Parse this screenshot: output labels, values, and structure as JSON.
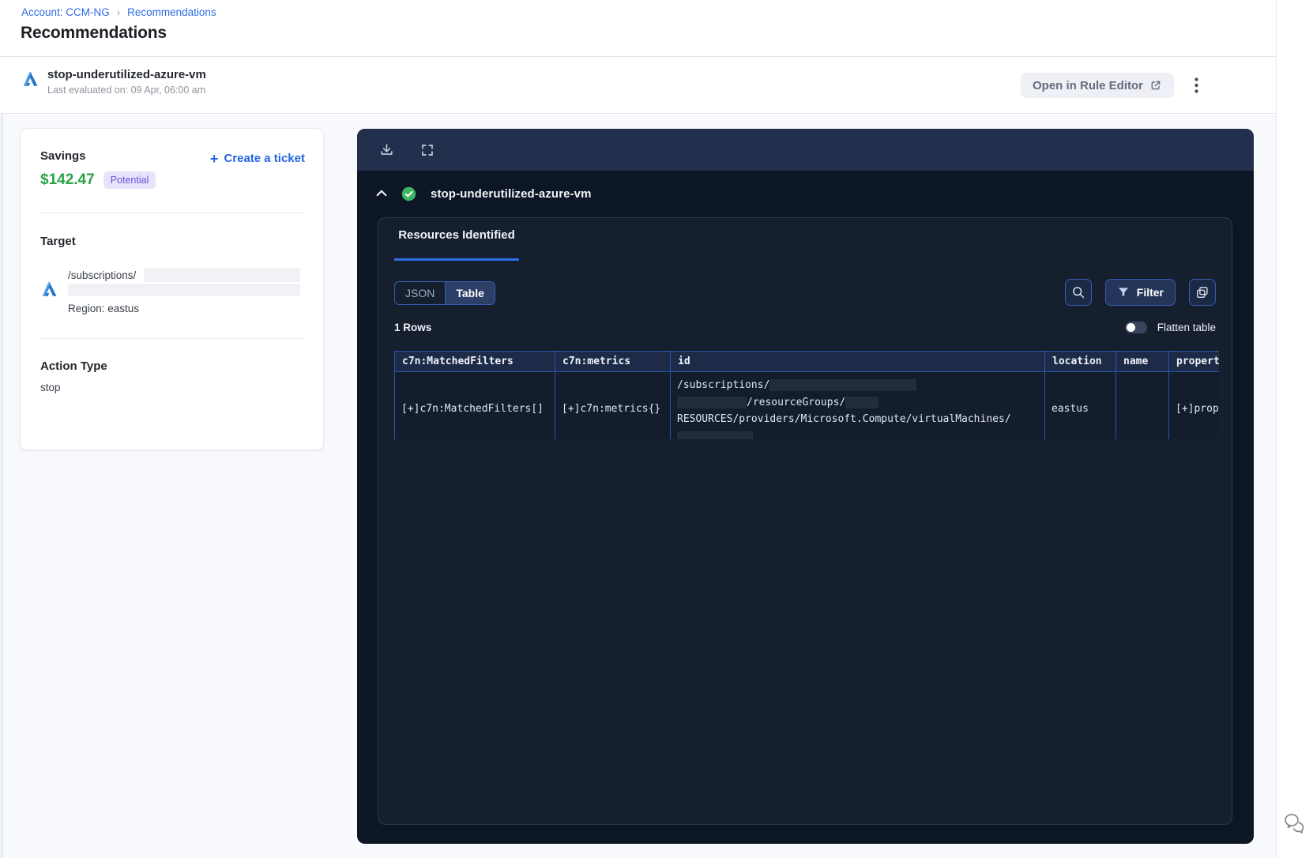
{
  "breadcrumb": {
    "account": "Account: CCM-NG",
    "separator": "›",
    "current": "Recommendations"
  },
  "page": {
    "title": "Recommendations"
  },
  "header": {
    "rule_name": "stop-underutilized-azure-vm",
    "last_evaluated": "Last evaluated on: 09 Apr, 06:00 am",
    "open_rule_editor_label": "Open in Rule Editor"
  },
  "card": {
    "savings_label": "Savings",
    "create_ticket_plus": "+",
    "create_ticket_label": "Create a ticket",
    "amount": "$142.47",
    "badge": "Potential",
    "target_label": "Target",
    "target_path": "/subscriptions/",
    "region": "Region: eastus",
    "action_type_label": "Action Type",
    "action_type_value": "stop"
  },
  "panel": {
    "rule_name": "stop-underutilized-azure-vm",
    "tab_label": "Resources Identified",
    "toggle": {
      "json_label": "JSON",
      "table_label": "Table"
    },
    "filter_label": "Filter",
    "rows_label": "1 Rows",
    "flatten_label": "Flatten table",
    "table": {
      "headers": [
        "c7n:MatchedFilters",
        "c7n:metrics",
        "id",
        "location",
        "name",
        "propert"
      ],
      "row": {
        "matched_filters": "[+]c7n:MatchedFilters[]",
        "metrics": "[+]c7n:metrics{}",
        "id_line1": "/subscriptions/",
        "id_line2": "/resourceGroups/",
        "id_line3": "RESOURCES/providers/Microsoft.Compute/virtualMachines/",
        "location": "eastus",
        "name": "",
        "properties": "[+]prop"
      }
    }
  },
  "colors": {
    "link_blue": "#2f6be4",
    "savings_green": "#27a346",
    "badge_purple_bg": "#e7e3fb",
    "badge_purple_text": "#6c50dd",
    "panel_bg": "#0d1624",
    "panel_toolbar_bg": "#222f4d",
    "inner_panel_bg": "#151f2e",
    "table_border_blue": "#2c55a9",
    "table_header_bg": "#1d2b49",
    "cell_link_blue": "#79bade",
    "success_green": "#3db563",
    "tab_underline_blue": "#2e6fe8"
  }
}
